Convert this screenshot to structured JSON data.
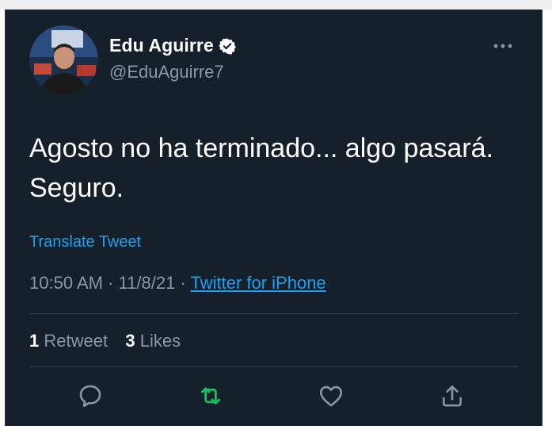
{
  "user": {
    "display_name": "Edu Aguirre",
    "handle": "@EduAguirre7",
    "verified": true
  },
  "tweet": {
    "text_line1": "Agosto no ha terminado... algo pasará.",
    "text_line2": "Seguro.",
    "translate_label": "Translate Tweet",
    "time": "10:50 AM",
    "separator": "·",
    "date": "11/8/21",
    "source": "Twitter for iPhone"
  },
  "stats": {
    "retweet_count": "1",
    "retweet_label": "Retweet",
    "like_count": "3",
    "like_label": "Likes"
  },
  "actions": [
    "reply-icon",
    "retweet-icon",
    "like-icon",
    "share-icon"
  ],
  "colors": {
    "background": "#15202b",
    "link": "#1da1f2",
    "secondary_text": "#8899a6",
    "retweet_accent": "#17bf63",
    "divider": "#38444d"
  }
}
